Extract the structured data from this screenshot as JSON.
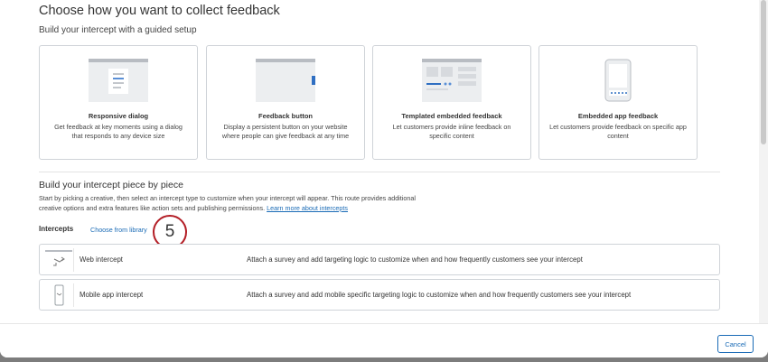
{
  "header": {
    "title": "Choose how you want to collect feedback",
    "subtitle": "Build your intercept with a guided setup"
  },
  "cards": [
    {
      "title": "Responsive dialog",
      "description": "Get feedback at key moments using a dialog that responds to any device size",
      "icon": "dialog-icon"
    },
    {
      "title": "Feedback button",
      "description": "Display a persistent button on your website where people can give feedback at any time",
      "icon": "feedback-button-icon"
    },
    {
      "title": "Templated embedded feedback",
      "description": "Let customers provide inline feedback on specific content",
      "icon": "embedded-feedback-icon"
    },
    {
      "title": "Embedded app feedback",
      "description": "Let customers provide feedback on specific app content",
      "icon": "mobile-app-icon"
    }
  ],
  "piece_section": {
    "title": "Build your intercept piece by piece",
    "description": "Start by picking a creative, then select an intercept type to customize when your intercept will appear. This route provides additional creative options and extra features like action sets and publishing permissions.",
    "learn_more_link": "Learn more about intercepts"
  },
  "intercepts": {
    "label": "Intercepts",
    "library_link": "Choose from library",
    "step_badge": "5",
    "rows": [
      {
        "name": "Web intercept",
        "description": "Attach a survey and add targeting logic to customize when and how frequently customers see your intercept",
        "icon": "web-intercept-icon"
      },
      {
        "name": "Mobile app intercept",
        "description": "Attach a survey and add mobile specific targeting logic to customize when and how frequently customers see your intercept",
        "icon": "mobile-intercept-icon"
      }
    ]
  },
  "footer": {
    "cancel_label": "Cancel"
  },
  "colors": {
    "accent": "#1a6bb6",
    "badge_border": "#b31d25",
    "overlay": "#7d7d7d"
  }
}
